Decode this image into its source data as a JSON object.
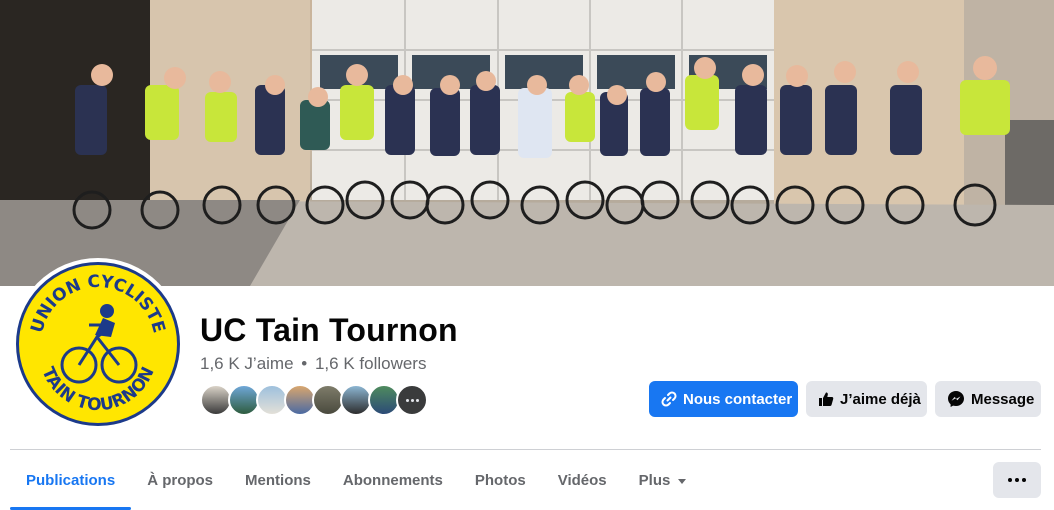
{
  "page": {
    "title": "UC Tain Tournon",
    "likes": "1,6 K J’aime",
    "separator": "•",
    "followers": "1,6 K followers"
  },
  "avatar": {
    "logo_text_top": "UNION CYCLISTE",
    "logo_text_bottom": "TAIN TOURNON"
  },
  "friend_avatars": [
    "friend-1",
    "friend-2",
    "friend-3",
    "friend-4",
    "friend-5",
    "friend-6",
    "friend-7"
  ],
  "actions": {
    "contact_label": "Nous contacter",
    "like_label": "J’aime déjà",
    "message_label": "Message"
  },
  "tabs": [
    {
      "label": "Publications",
      "active": true
    },
    {
      "label": "À propos"
    },
    {
      "label": "Mentions"
    },
    {
      "label": "Abonnements"
    },
    {
      "label": "Photos"
    },
    {
      "label": "Vidéos"
    },
    {
      "label": "Plus"
    }
  ],
  "icons": {
    "contact": "link-icon",
    "like": "thumbs-up-icon",
    "message": "messenger-icon",
    "more_tab": "caret-down-icon",
    "overflow": "ellipsis-icon"
  },
  "colors": {
    "accent": "#1877f2",
    "secondary_button": "#e4e6eb",
    "muted_text": "#65676b",
    "logo_yellow": "#ffe600",
    "logo_blue": "#1c3a8a"
  }
}
